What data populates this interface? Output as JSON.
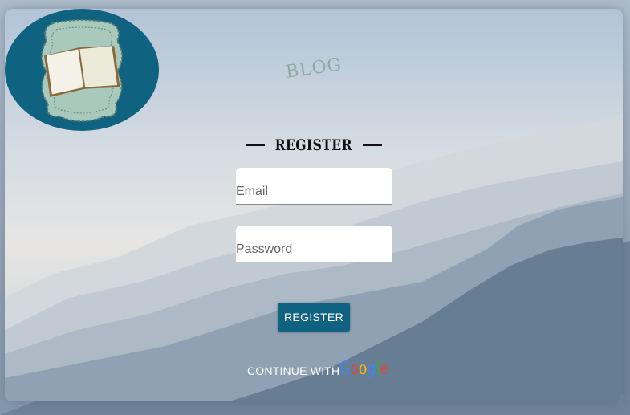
{
  "logo": {
    "text": "BLOG"
  },
  "form": {
    "heading": "REGISTER",
    "email_placeholder": "Email",
    "password_placeholder": "Password",
    "submit_label": "REGISTER"
  },
  "social": {
    "continue_label": "CONTINUE WITH",
    "provider_letters": [
      "G",
      "o",
      "o",
      "g",
      "l",
      "e"
    ],
    "provider_colors": [
      "#4285f4",
      "#ea4335",
      "#fbbc05",
      "#4285f4",
      "#34a853",
      "#ea4335"
    ]
  },
  "colors": {
    "primary": "#0f6381",
    "logo_ring": "#0f6381",
    "logo_panel": "#a9c9bd"
  }
}
